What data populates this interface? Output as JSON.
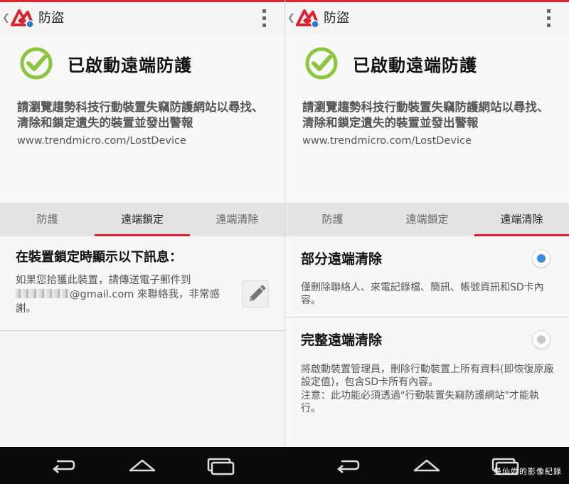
{
  "app": {
    "title": "防盜",
    "status_title": "已啟動遠端防護",
    "status_desc": "請瀏覽趨勢科技行動裝置失竊防護網站以尋找、清除和鎖定遺失的裝置並發出警報",
    "url": "www.trendmicro.com/LostDevice"
  },
  "tabs": [
    "防護",
    "遠端鎖定",
    "遠端清除"
  ],
  "left_screen": {
    "active_tab": "遠端鎖定",
    "lock_heading": "在裝置鎖定時顯示以下訊息：",
    "lock_msg_line1": "如果您拾獲此裝置，請傳送電子郵件到",
    "lock_msg_email": "@gmail.com",
    "lock_msg_rest": " 來聯絡我，非常感謝。"
  },
  "right_screen": {
    "active_tab": "遠端清除",
    "partial": {
      "title": "部分遠端清除",
      "desc": "僅刪除聯絡人、來電記錄檔、簡訊、帳號資訊和SD卡內容。",
      "selected": true
    },
    "full": {
      "title": "完整遠端清除",
      "desc": "將啟動裝置管理員，刪除行動裝置上所有資料(即恢復原廠設定值)，包含SD卡所有內容。",
      "note": "注意：此功能必須透過\"行動裝置失竊防護網站\"才能執行。",
      "selected": false
    }
  },
  "watermark": "曼仙姓的影像紀錄",
  "colors": {
    "accent": "#d9242f",
    "check_green": "#8cc63f",
    "radio_blue": "#3a8dde",
    "radio_grey": "#c8c8c8"
  },
  "icons": [
    "back-chevron-icon",
    "trendmicro-logo-icon",
    "overflow-menu-icon",
    "check-circle-icon",
    "pencil-icon",
    "nav-back-icon",
    "nav-home-icon",
    "nav-recents-icon"
  ]
}
